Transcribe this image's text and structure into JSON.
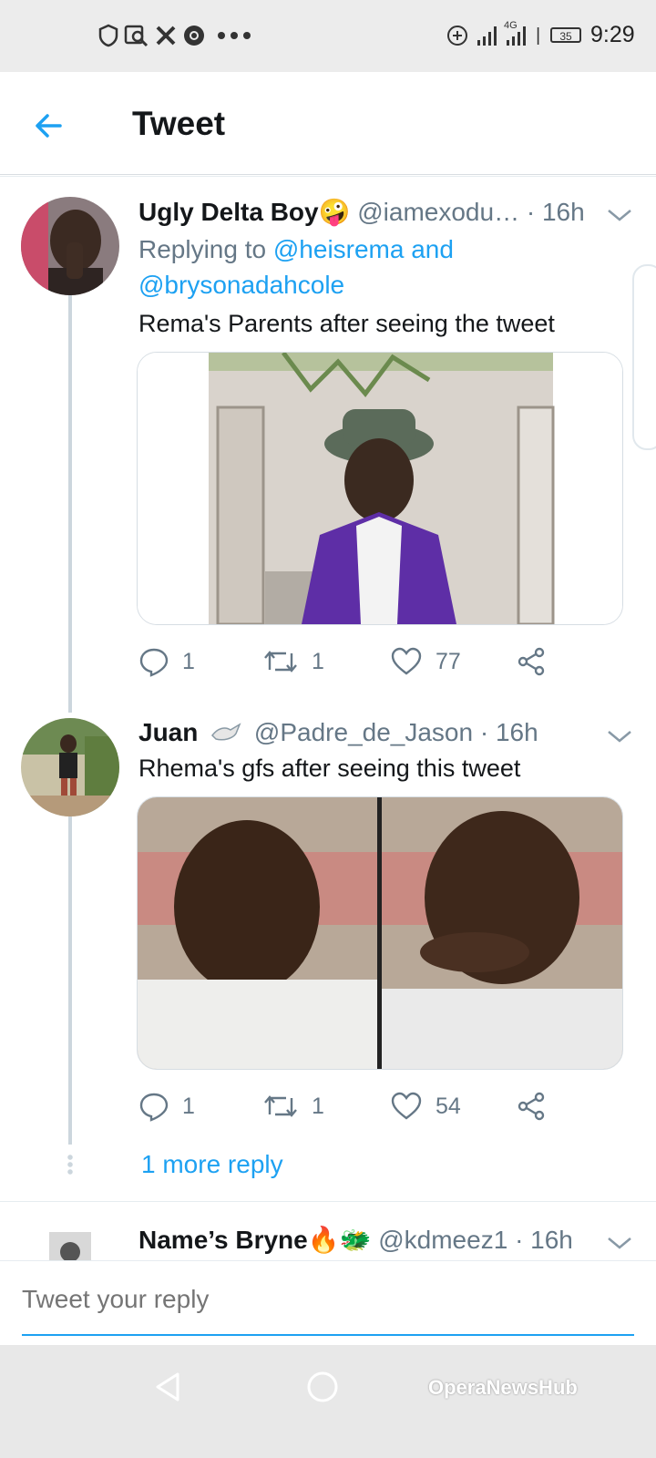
{
  "status_bar": {
    "time": "9:29",
    "battery": "35",
    "network": "4G",
    "left_icons": [
      "shield-icon",
      "search-image-icon",
      "x-icon",
      "chrome-icon",
      "more-dots-icon"
    ]
  },
  "header": {
    "title": "Tweet",
    "back_icon": "arrow-left-icon"
  },
  "tweets": [
    {
      "name": "Ugly Delta Boy🤪",
      "handle": "@iamexodu…",
      "time": "· 16h",
      "replying_prefix": "Replying to",
      "replying_to": "@heisrema and @brysonadahcole",
      "text": "Rema's Parents after seeing the tweet",
      "replies": "1",
      "retweets": "1",
      "likes": "77"
    },
    {
      "name": "Juan",
      "handle": "@Padre_de_Jason",
      "time": "· 16h",
      "text": "Rhema's gfs after seeing this tweet",
      "replies": "1",
      "retweets": "1",
      "likes": "54"
    },
    {
      "name": "Name’s Bryne🔥🐲",
      "handle": "@kdmeez1",
      "time": "· 16h"
    }
  ],
  "more_reply": "1 more reply",
  "composer": {
    "placeholder": "Tweet your reply"
  },
  "watermark": "OperaNewsHub",
  "colors": {
    "accent": "#1da1f2",
    "muted": "#657786",
    "text": "#14171a"
  }
}
